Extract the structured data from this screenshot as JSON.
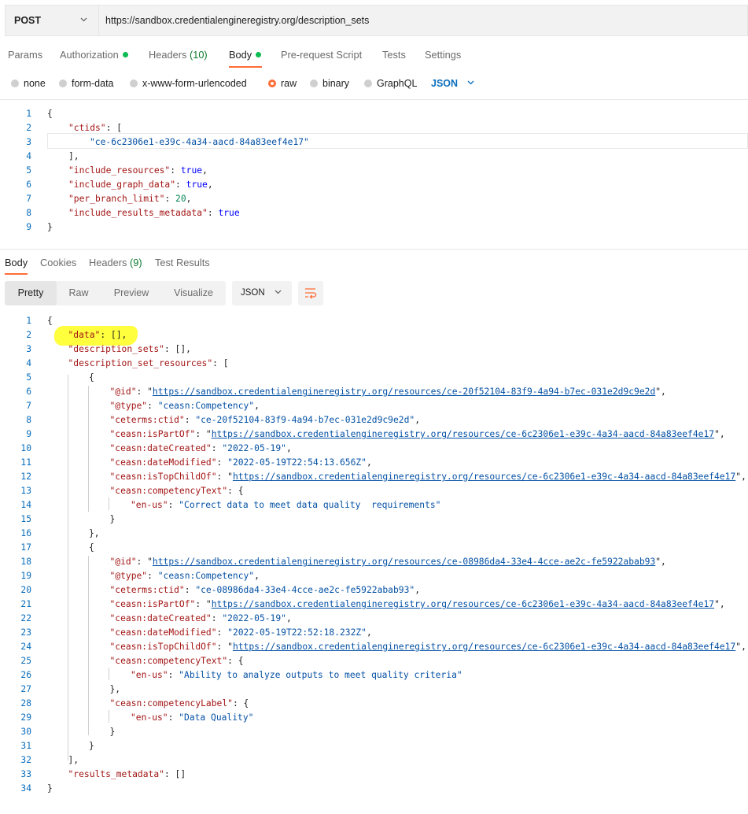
{
  "request": {
    "method": "POST",
    "url": "https://sandbox.credentialengineregistry.org/description_sets"
  },
  "request_tabs": {
    "params": "Params",
    "authorization": "Authorization",
    "headers": "Headers",
    "headers_count": "(10)",
    "body": "Body",
    "pre_request": "Pre-request Script",
    "tests": "Tests",
    "settings": "Settings"
  },
  "body_types": {
    "none": "none",
    "form_data": "form-data",
    "urlencoded": "x-www-form-urlencoded",
    "raw": "raw",
    "binary": "binary",
    "graphql": "GraphQL",
    "format": "JSON"
  },
  "request_body": {
    "line_numbers": [
      "1",
      "2",
      "3",
      "4",
      "5",
      "6",
      "7",
      "8",
      "9"
    ],
    "open_brace": "{",
    "ctids_key": "\"ctids\"",
    "open_bracket": "[",
    "ctid_value": "\"ce-6c2306e1-e39c-4a34-aacd-84a83eef4e17\"",
    "close_bracket": "],",
    "include_resources_key": "\"include_resources\"",
    "include_graph_data_key": "\"include_graph_data\"",
    "per_branch_limit_key": "\"per_branch_limit\"",
    "per_branch_limit_value": "20",
    "include_results_metadata_key": "\"include_results_metadata\"",
    "true": "true",
    "close_brace": "}"
  },
  "response_tabs": {
    "body": "Body",
    "cookies": "Cookies",
    "headers": "Headers",
    "headers_count": "(9)",
    "test_results": "Test Results"
  },
  "view_modes": {
    "pretty": "Pretty",
    "raw": "Raw",
    "preview": "Preview",
    "visualize": "Visualize",
    "format": "JSON"
  },
  "response_body": {
    "line_numbers": [
      "1",
      "2",
      "3",
      "4",
      "5",
      "6",
      "7",
      "8",
      "9",
      "10",
      "11",
      "12",
      "13",
      "14",
      "15",
      "16",
      "17",
      "18",
      "19",
      "20",
      "21",
      "22",
      "23",
      "24",
      "25",
      "26",
      "27",
      "28",
      "29",
      "30",
      "31",
      "32",
      "33",
      "34"
    ],
    "data_key": "\"data\"",
    "description_sets_key": "\"description_sets\"",
    "description_set_resources_key": "\"description_set_resources\"",
    "results_metadata_key": "\"results_metadata\"",
    "empty_array": "[]",
    "k_id": "\"@id\"",
    "k_type": "\"@type\"",
    "k_ctid": "\"ceterms:ctid\"",
    "k_ispartof": "\"ceasn:isPartOf\"",
    "k_datecreated": "\"ceasn:dateCreated\"",
    "k_datemodified": "\"ceasn:dateModified\"",
    "k_istopchildof": "\"ceasn:isTopChildOf\"",
    "k_competencytext": "\"ceasn:competencyText\"",
    "k_competencylabel": "\"ceasn:competencyLabel\"",
    "k_enus": "\"en-us\"",
    "type_value": "\"ceasn:Competency\"",
    "parent_url": "https://sandbox.credentialengineregistry.org/resources/ce-6c2306e1-e39c-4a34-aacd-84a83eef4e17",
    "r1_id": "https://sandbox.credentialengineregistry.org/resources/ce-20f52104-83f9-4a94-b7ec-031e2d9c9e2d",
    "r1_ctid": "\"ce-20f52104-83f9-4a94-b7ec-031e2d9c9e2d\"",
    "r1_created": "\"2022-05-19\"",
    "r1_modified": "\"2022-05-19T22:54:13.656Z\"",
    "r1_text": "\"Correct data to meet data quality  requirements\"",
    "r2_id": "https://sandbox.credentialengineregistry.org/resources/ce-08986da4-33e4-4cce-ae2c-fe5922abab93",
    "r2_ctid": "\"ce-08986da4-33e4-4cce-ae2c-fe5922abab93\"",
    "r2_created": "\"2022-05-19\"",
    "r2_modified": "\"2022-05-19T22:52:18.232Z\"",
    "r2_text": "\"Ability to analyze outputs to meet quality criteria\"",
    "r2_label": "\"Data Quality\""
  }
}
